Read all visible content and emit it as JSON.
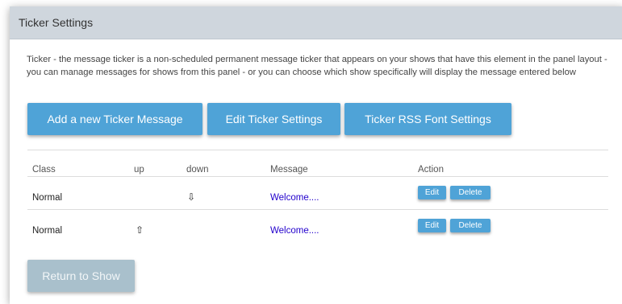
{
  "panel": {
    "title": "Ticker Settings",
    "description": "Ticker - the message ticker is a non-scheduled permanent message ticker that appears on your shows that have this element in the panel layout - you can manage messages for shows from this panel - or you can choose which show specifically will display the message entered below"
  },
  "buttons": {
    "add": "Add a new Ticker Message",
    "edit_settings": "Edit Ticker Settings",
    "rss_font": "Ticker RSS Font Settings",
    "return": "Return to Show"
  },
  "table": {
    "headers": {
      "class": "Class",
      "up": "up",
      "down": "down",
      "message": "Message",
      "action": "Action"
    },
    "rows": [
      {
        "class": "Normal",
        "up": "",
        "down": "⇩",
        "message": "Welcome....",
        "edit": "Edit",
        "delete": "Delete"
      },
      {
        "class": "Normal",
        "up": "⇧",
        "down": "",
        "message": "Welcome....",
        "edit": "Edit",
        "delete": "Delete"
      }
    ]
  },
  "colors": {
    "accent": "#4fa3d7",
    "header_bg": "#cfd6dd",
    "return_button": "#a9c0cc",
    "link": "#2200cc"
  }
}
